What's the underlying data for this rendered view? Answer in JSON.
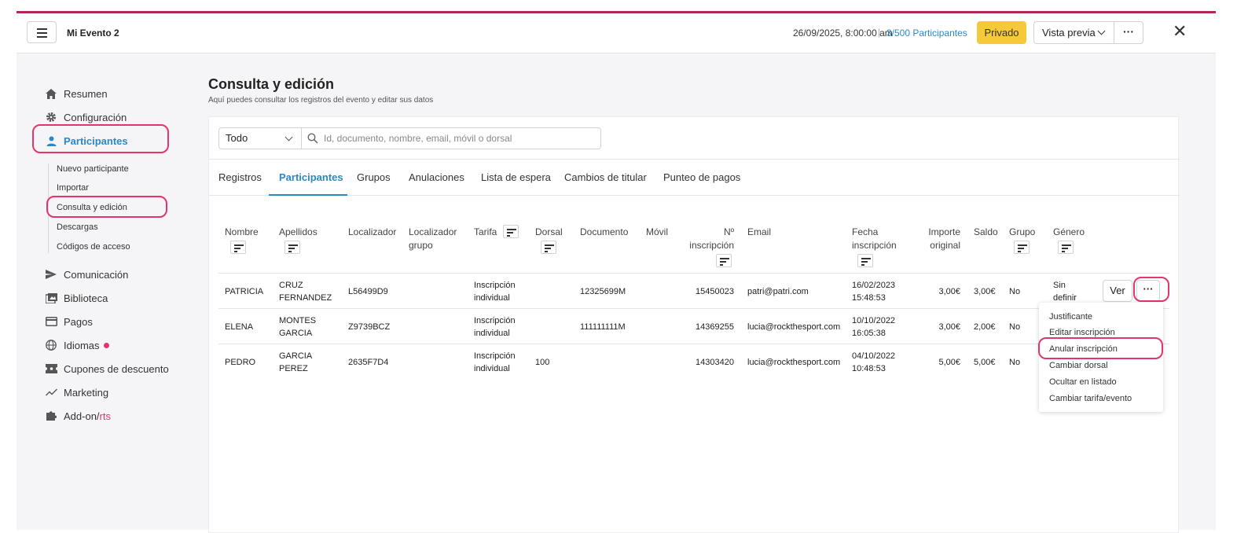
{
  "header": {
    "event_name": "Mi Evento 2",
    "date": "26/09/2025, 8:00:00 am",
    "separator": "|",
    "participants_count": "3/500",
    "participants_label": "Participantes",
    "privacy_label": "Privado",
    "preview_label": "Vista previa",
    "more_label": "···",
    "close_label": "✕"
  },
  "sidebar": {
    "items": [
      {
        "label": "Resumen",
        "icon": "home-icon"
      },
      {
        "label": "Configuración",
        "icon": "gear-icon"
      },
      {
        "label": "Participantes",
        "icon": "person-icon"
      },
      {
        "label": "Comunicación",
        "icon": "send-icon"
      },
      {
        "label": "Biblioteca",
        "icon": "library-icon"
      },
      {
        "label": "Pagos",
        "icon": "card-icon"
      },
      {
        "label": "Idiomas",
        "icon": "globe-icon"
      },
      {
        "label": "Cupones de descuento",
        "icon": "ticket-icon"
      },
      {
        "label": "Marketing",
        "icon": "trend-icon"
      },
      {
        "label_a": "Add-on/",
        "label_b": "rts",
        "icon": "puzzle-icon"
      }
    ],
    "subitems": [
      "Nuevo participante",
      "Importar",
      "Consulta y edición",
      "Descargas",
      "Códigos de acceso"
    ]
  },
  "main": {
    "title": "Consulta y edición",
    "subtitle": "Aquí puedes consultar los registros del evento y editar sus datos"
  },
  "filter": {
    "select_value": "Todo",
    "search_placeholder": "Id, documento, nombre, email, móvil o dorsal"
  },
  "tabs": [
    "Registros",
    "Participantes",
    "Grupos",
    "Anulaciones",
    "Lista de espera",
    "Cambios de titular",
    "Punteo de pagos"
  ],
  "table": {
    "headers": {
      "nombre": "Nombre",
      "apellidos": "Apellidos",
      "localizador": "Localizador",
      "localizador_grupo_1": "Localizador",
      "localizador_grupo_2": "grupo",
      "tarifa": "Tarifa",
      "dorsal": "Dorsal",
      "documento": "Documento",
      "movil": "Móvil",
      "n_inscripcion_1": "Nº",
      "n_inscripcion_2": "inscripción",
      "email": "Email",
      "fecha_1": "Fecha",
      "fecha_2": "inscripción",
      "importe_1": "Importe",
      "importe_2": "original",
      "saldo": "Saldo",
      "grupo": "Grupo",
      "genero": "Género"
    },
    "rows": [
      {
        "nombre": "PATRICIA",
        "ap1": "CRUZ",
        "ap2": "FERNANDEZ",
        "localizador": "L56499D9",
        "tarifa1": "Inscripción",
        "tarifa2": "individual",
        "dorsal": "",
        "documento": "12325699M",
        "movil": "",
        "n_insc": "15450023",
        "email": "patri@patri.com",
        "fecha1": "16/02/2023",
        "fecha2": "15:48:53",
        "importe": "3,00€",
        "saldo": "3,00€",
        "grupo": "No",
        "genero1": "Sin",
        "genero2": "definir"
      },
      {
        "nombre": "ELENA",
        "ap1": "MONTES",
        "ap2": "GARCIA",
        "localizador": "Z9739BCZ",
        "tarifa1": "Inscripción",
        "tarifa2": "individual",
        "dorsal": "",
        "documento": "111111111M",
        "movil": "",
        "n_insc": "14369255",
        "email": "lucia@rockthesport.com",
        "fecha1": "10/10/2022",
        "fecha2": "16:05:38",
        "importe": "3,00€",
        "saldo": "2,00€",
        "grupo": "No",
        "genero1": "",
        "genero2": ""
      },
      {
        "nombre": "PEDRO",
        "ap1": "GARCIA",
        "ap2": "PEREZ",
        "localizador": "2635F7D4",
        "tarifa1": "Inscripción",
        "tarifa2": "individual",
        "dorsal": "100",
        "documento": "",
        "movil": "",
        "n_insc": "14303420",
        "email": "lucia@rockthesport.com",
        "fecha1": "04/10/2022",
        "fecha2": "10:48:53",
        "importe": "5,00€",
        "saldo": "5,00€",
        "grupo": "No",
        "genero1": "",
        "genero2": ""
      }
    ],
    "view_label": "Ver",
    "more_label": "···"
  },
  "dropdown": {
    "items": [
      "Justificante",
      "Editar inscripción",
      "Anular inscripción",
      "Cambiar dorsal",
      "Ocultar en listado",
      "Cambiar tarifa/evento"
    ]
  },
  "colors": {
    "accent": "#2b88c8",
    "highlight": "#e2356b",
    "privado": "#f6c93a",
    "brand_bar": "#b5245a"
  }
}
